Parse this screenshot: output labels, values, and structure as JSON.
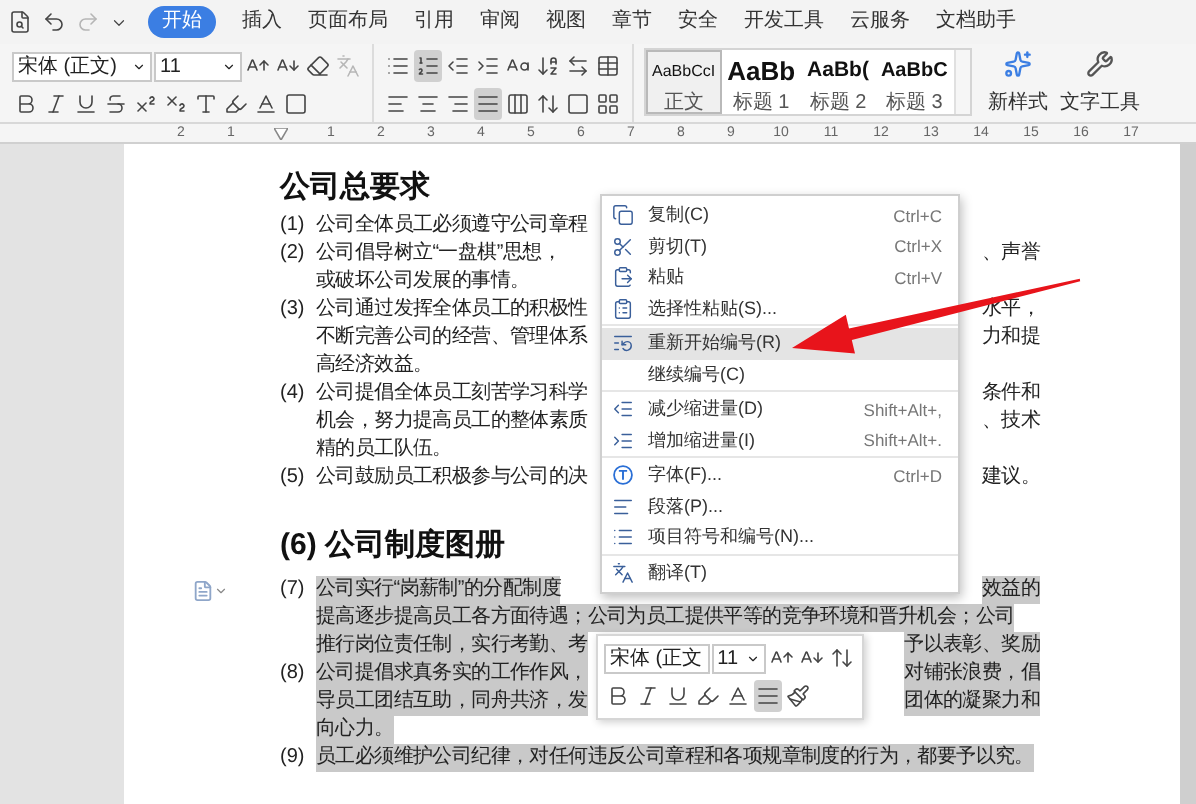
{
  "quick_access": [
    {
      "kind": "preview",
      "disabled": false
    },
    {
      "kind": "undo",
      "disabled": false
    },
    {
      "kind": "redo",
      "disabled": true
    },
    {
      "kind": "more",
      "disabled": false
    }
  ],
  "tabs": [
    {
      "label": "开始",
      "selected": true
    },
    {
      "label": "插入",
      "selected": false
    },
    {
      "label": "页面布局",
      "selected": false
    },
    {
      "label": "引用",
      "selected": false
    },
    {
      "label": "审阅",
      "selected": false
    },
    {
      "label": "视图",
      "selected": false
    },
    {
      "label": "章节",
      "selected": false
    },
    {
      "label": "安全",
      "selected": false
    },
    {
      "label": "开发工具",
      "selected": false
    },
    {
      "label": "云服务",
      "selected": false
    },
    {
      "label": "文档助手",
      "selected": false
    }
  ],
  "ribbon": {
    "font_name": "宋体 (正文)",
    "font_size": "11",
    "font_tools_top": [
      {
        "kind": "grow",
        "selected": false,
        "disabled": false
      },
      {
        "kind": "shrink",
        "selected": false,
        "disabled": false
      },
      {
        "kind": "clear",
        "selected": false,
        "disabled": false
      },
      {
        "kind": "phonetic",
        "selected": false,
        "disabled": true
      }
    ],
    "font_tools": [
      {
        "kind": "bold",
        "selected": false,
        "disabled": false
      },
      {
        "kind": "italic",
        "selected": false,
        "disabled": false
      },
      {
        "kind": "underline",
        "selected": false,
        "disabled": false
      },
      {
        "kind": "strikethrough",
        "selected": false,
        "disabled": false
      },
      {
        "kind": "superscript",
        "selected": false,
        "disabled": false
      },
      {
        "kind": "subscript",
        "selected": false,
        "disabled": false
      },
      {
        "kind": "effect",
        "selected": false,
        "disabled": false
      },
      {
        "kind": "highlight",
        "selected": false,
        "disabled": false
      },
      {
        "kind": "font-color",
        "selected": false,
        "disabled": false
      },
      {
        "kind": "shading",
        "selected": false,
        "disabled": false
      }
    ],
    "para_tools_top": [
      {
        "kind": "bullets",
        "selected": false,
        "disabled": false
      },
      {
        "kind": "numbering",
        "selected": true,
        "disabled": false
      },
      {
        "kind": "outdent",
        "selected": false,
        "disabled": false
      },
      {
        "kind": "indent",
        "selected": false,
        "disabled": false
      },
      {
        "kind": "asian",
        "selected": false,
        "disabled": false
      },
      {
        "kind": "sort",
        "selected": false,
        "disabled": false
      },
      {
        "kind": "tabs",
        "selected": false,
        "disabled": false
      },
      {
        "kind": "frame",
        "selected": false,
        "disabled": false
      }
    ],
    "para_tools": [
      {
        "kind": "align-left",
        "selected": false,
        "disabled": false
      },
      {
        "kind": "align-center",
        "selected": false,
        "disabled": false
      },
      {
        "kind": "align-right",
        "selected": false,
        "disabled": false
      },
      {
        "kind": "justify",
        "selected": true,
        "disabled": false
      },
      {
        "kind": "distribute",
        "selected": false,
        "disabled": false
      },
      {
        "kind": "line-spacing",
        "selected": false,
        "disabled": false
      },
      {
        "kind": "shading",
        "selected": false,
        "disabled": false
      },
      {
        "kind": "borders",
        "selected": false,
        "disabled": false
      }
    ],
    "styles": [
      {
        "sample": "AaBbCcI",
        "label": "正文",
        "kind": "body",
        "selected": true
      },
      {
        "sample": "AaBb",
        "label": "标题 1",
        "kind": "h1",
        "selected": false
      },
      {
        "sample": "AaBb(",
        "label": "标题 2",
        "kind": "h2",
        "selected": false
      },
      {
        "sample": "AaBbC",
        "label": "标题 3",
        "kind": "h3",
        "selected": false
      }
    ],
    "new_style": "新样式",
    "text_tools": "文字工具"
  },
  "ruler": {
    "left_labels": [
      "2",
      "1"
    ],
    "labels": [
      "1",
      "2",
      "3",
      "4",
      "5",
      "6",
      "7",
      "8",
      "9",
      "10",
      "11",
      "12",
      "13",
      "14",
      "15",
      "16",
      "17"
    ]
  },
  "document": {
    "sections": [
      {
        "heading": "公司总要求",
        "paragraphs": [
          {
            "number": "(1)",
            "selected": false,
            "lines": [
              {
                "text": "公司全体员工必须遵守公司章程"
              }
            ]
          },
          {
            "number": "(2)",
            "selected": false,
            "lines": [
              {
                "text": "公司倡导树立“一盘棋”思想，",
                "right": "、声誉"
              },
              {
                "text": "或破坏公司发展的事情。"
              }
            ]
          },
          {
            "number": "(3)",
            "selected": false,
            "lines": [
              {
                "text": "公司通过发挥全体员工的积极性",
                "right": "水平，"
              },
              {
                "text": "不断完善公司的经营、管理体系",
                "right": "力和提"
              },
              {
                "text": "高经济效益。"
              }
            ]
          },
          {
            "number": "(4)",
            "selected": false,
            "lines": [
              {
                "text": "公司提倡全体员工刻苦学习科学",
                "right": "条件和"
              },
              {
                "text": "机会，努力提高员工的整体素质",
                "right": "、技术"
              },
              {
                "text": "精的员工队伍。"
              }
            ]
          },
          {
            "number": "(5)",
            "selected": false,
            "lines": [
              {
                "text": "公司鼓励员工积极参与公司的决",
                "right": "建议。"
              }
            ]
          }
        ]
      },
      {
        "heading": "(6) 公司制度图册",
        "paragraphs": [
          {
            "number": "(7)",
            "selected": true,
            "lines": [
              {
                "text": "公司实行“岗薪制”的分配制度",
                "right": "效益的"
              },
              {
                "text": "提高逐步提高员工各方面待遇；公司为员工提供平等的竞争环境和晋升机会；公司"
              },
              {
                "text": "推行岗位责任制，实行考勤、考",
                "right": "予以表彰、奖励"
              }
            ]
          },
          {
            "number": "(8)",
            "selected": true,
            "lines": [
              {
                "text": "公司提倡求真务实的工作作风，",
                "right": "对铺张浪费，倡"
              },
              {
                "text": "导员工团结互助，同舟共济，发",
                "right": "团体的凝聚力和"
              },
              {
                "text": "向心力。"
              }
            ]
          },
          {
            "number": "(9)",
            "selected": true,
            "lines": [
              {
                "text": "员工必须维护公司纪律，对任何违反公司章程和各项规章制度的行为，都要予以究。"
              }
            ]
          }
        ]
      }
    ]
  },
  "context_menu": {
    "groups": [
      {
        "items": [
          {
            "kind": "copy",
            "label": "复制(C)",
            "shortcut": "Ctrl+C",
            "selected": false
          },
          {
            "kind": "cut",
            "label": "剪切(T)",
            "shortcut": "Ctrl+X",
            "selected": false
          },
          {
            "kind": "paste",
            "label": "粘贴",
            "shortcut": "Ctrl+V",
            "selected": false
          },
          {
            "kind": "paste-special",
            "label": "选择性粘贴(S)...",
            "selected": false
          }
        ]
      },
      {
        "items": [
          {
            "kind": "restart",
            "label": "重新开始编号(R)",
            "selected": true
          },
          {
            "kind": "continue",
            "label": "继续编号(C)",
            "selected": false
          }
        ]
      },
      {
        "items": [
          {
            "kind": "outdent",
            "label": "减少缩进量(D)",
            "shortcut": "Shift+Alt+,",
            "selected": false
          },
          {
            "kind": "indent",
            "label": "增加缩进量(I)",
            "shortcut": "Shift+Alt+.",
            "selected": false
          }
        ]
      },
      {
        "items": [
          {
            "kind": "font",
            "label": "字体(F)...",
            "shortcut": "Ctrl+D",
            "selected": false
          },
          {
            "kind": "paragraph",
            "label": "段落(P)...",
            "selected": false
          },
          {
            "kind": "bullets",
            "label": "项目符号和编号(N)...",
            "selected": false
          }
        ]
      },
      {
        "items": [
          {
            "kind": "translate",
            "label": "翻译(T)",
            "selected": false
          }
        ]
      }
    ]
  },
  "mini_toolbar": {
    "font_name": "宋体 (正文",
    "font_size": "11",
    "tools_top": [
      {
        "kind": "grow",
        "selected": false,
        "disabled": false
      },
      {
        "kind": "shrink",
        "selected": false,
        "disabled": false
      },
      {
        "kind": "line-spacing",
        "selected": false,
        "disabled": false
      }
    ],
    "tools": [
      {
        "kind": "bold",
        "selected": false,
        "disabled": false
      },
      {
        "kind": "italic",
        "selected": false,
        "disabled": false
      },
      {
        "kind": "underline",
        "selected": false,
        "disabled": false
      },
      {
        "kind": "highlight",
        "selected": false,
        "disabled": false
      },
      {
        "kind": "font-color",
        "selected": false,
        "disabled": false
      },
      {
        "kind": "justify",
        "selected": true,
        "disabled": false
      },
      {
        "kind": "format-painter",
        "selected": false,
        "disabled": false
      }
    ]
  }
}
